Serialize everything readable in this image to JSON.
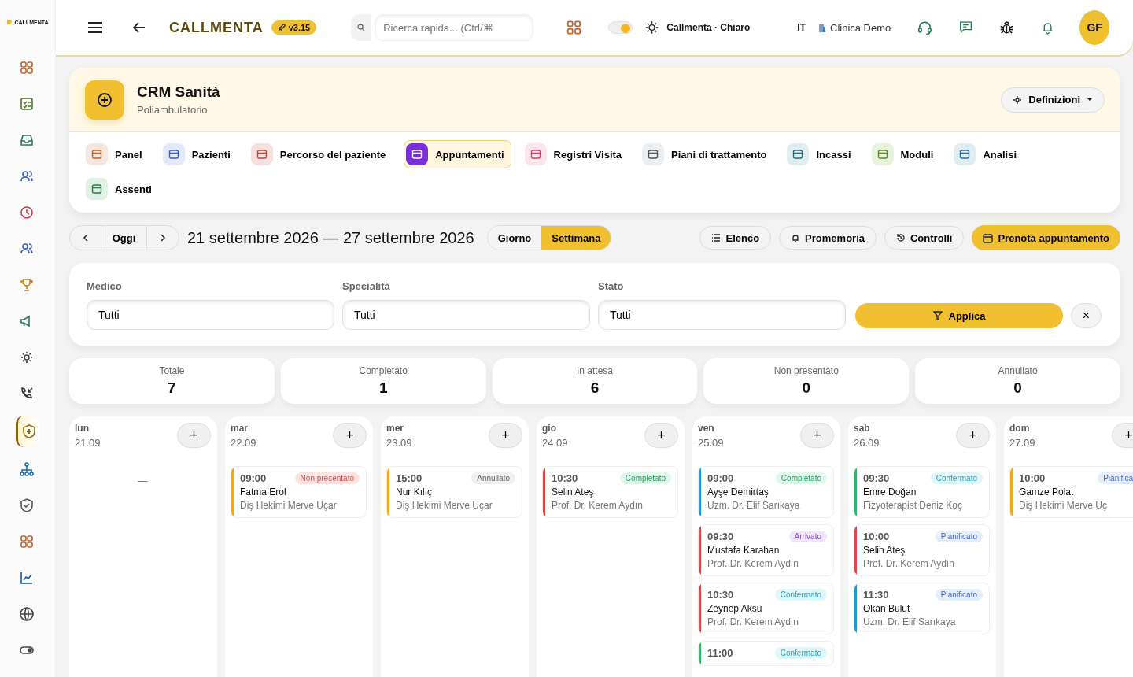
{
  "sidebar": {
    "logo": "CALLMENTA",
    "items": [
      {
        "selected": false
      },
      {
        "selected": false
      },
      {
        "selected": false
      },
      {
        "selected": false
      },
      {
        "selected": false
      },
      {
        "selected": false
      },
      {
        "selected": false
      },
      {
        "selected": false
      },
      {
        "selected": false
      },
      {
        "selected": false
      },
      {
        "selected": true
      },
      {
        "selected": false
      },
      {
        "selected": false
      },
      {
        "selected": false
      },
      {
        "selected": false
      },
      {
        "selected": false
      },
      {
        "selected": false
      }
    ]
  },
  "header": {
    "brand": "CALLMENTA",
    "version": "v3.15",
    "search": {
      "placeholder": "Ricerca rapida... (Ctrl/⌘"
    },
    "theme_toggle": {
      "on": true
    },
    "theme": "Callmenta · Chiaro",
    "language": "IT",
    "clinic": "Clinica Demo",
    "avatar": "GF"
  },
  "module": {
    "title": "CRM Sanità",
    "subtitle": "Poliambulatorio",
    "definitions": "Definizioni",
    "tabs": [
      {
        "label": "Panel",
        "selected": false
      },
      {
        "label": "Pazienti",
        "selected": false
      },
      {
        "label": "Percorso del paziente",
        "selected": false
      },
      {
        "label": "Appuntamenti",
        "selected": true
      },
      {
        "label": "Registri Visita",
        "selected": false
      },
      {
        "label": "Piani di trattamento",
        "selected": false
      },
      {
        "label": "Incassi",
        "selected": false
      },
      {
        "label": "Moduli",
        "selected": false
      },
      {
        "label": "Analisi",
        "selected": false
      },
      {
        "label": "Assenti",
        "selected": false
      }
    ]
  },
  "toolbar": {
    "today": "Oggi",
    "range": "21 settembre 2026 — 27 settembre 2026",
    "views": [
      {
        "label": "Giorno",
        "selected": false
      },
      {
        "label": "Settimana",
        "selected": true
      }
    ],
    "actions": [
      "Elenco",
      "Promemoria",
      "Controlli"
    ],
    "book": "Prenota appuntamento"
  },
  "filters": {
    "fields": [
      {
        "label": "Medico",
        "value": "Tutti"
      },
      {
        "label": "Specialità",
        "value": "Tutti"
      },
      {
        "label": "Stato",
        "value": "Tutti"
      }
    ],
    "apply": "Applica",
    "clear": "×"
  },
  "stats": [
    {
      "label": "Totale",
      "value": "7"
    },
    {
      "label": "Completato",
      "value": "1"
    },
    {
      "label": "In attesa",
      "value": "6"
    },
    {
      "label": "Non presentato",
      "value": "0"
    },
    {
      "label": "Annullato",
      "value": "0"
    }
  ],
  "days": [
    {
      "name": "lun",
      "date": "21.09",
      "add": "+",
      "empty": "—"
    },
    {
      "name": "mar",
      "date": "22.09",
      "add": "+",
      "appointments": [
        {
          "time": "09:00",
          "status": "Non presentato",
          "kind": "missed",
          "patient": "Fatma Erol",
          "doctor": "Diş Hekimi Merve Uçar",
          "color": "#f0a81c"
        }
      ]
    },
    {
      "name": "mer",
      "date": "23.09",
      "add": "+",
      "appointments": [
        {
          "time": "15:00",
          "status": "Annullato",
          "kind": "cancelled",
          "patient": "Nur Kılıç",
          "doctor": "Diş Hekimi Merve Uçar",
          "color": "#f0a81c"
        }
      ]
    },
    {
      "name": "gio",
      "date": "24.09",
      "add": "+",
      "appointments": [
        {
          "time": "10:30",
          "status": "Completato",
          "kind": "done",
          "patient": "Selin Ateş",
          "doctor": "Prof. Dr. Kerem Aydın",
          "color": "#e04848"
        }
      ]
    },
    {
      "name": "ven",
      "date": "25.09",
      "add": "+",
      "appointments": [
        {
          "time": "09:00",
          "status": "Completato",
          "kind": "done",
          "patient": "Ayşe Demirtaş",
          "doctor": "Uzm. Dr. Elif Sarıkaya",
          "color": "#1a9ad6"
        },
        {
          "time": "09:30",
          "status": "Arrivato",
          "kind": "arrived",
          "patient": "Mustafa Karahan",
          "doctor": "Prof. Dr. Kerem Aydın",
          "color": "#e04848"
        },
        {
          "time": "10:30",
          "status": "Confermato",
          "kind": "confirmed",
          "patient": "Zeynep Aksu",
          "doctor": "Prof. Dr. Kerem Aydın",
          "color": "#e04848"
        },
        {
          "time": "11:00",
          "status": "Confermato",
          "kind": "confirmed",
          "color": "#2fb86a"
        }
      ]
    },
    {
      "name": "sab",
      "date": "26.09",
      "add": "+",
      "appointments": [
        {
          "time": "09:30",
          "status": "Confermato",
          "kind": "confirmed",
          "patient": "Emre Doğan",
          "doctor": "Fizyoterapist Deniz Koç",
          "color": "#2fb86a"
        },
        {
          "time": "10:00",
          "status": "Pianificato",
          "kind": "planned",
          "patient": "Selin Ateş",
          "doctor": "Prof. Dr. Kerem Aydın",
          "color": "#e04848"
        },
        {
          "time": "11:30",
          "status": "Pianificato",
          "kind": "planned",
          "patient": "Okan Bulut",
          "doctor": "Uzm. Dr. Elif Sarıkaya",
          "color": "#1a9ad6"
        }
      ]
    },
    {
      "name": "dom",
      "date": "27.09",
      "add": "+",
      "appointments": [
        {
          "time": "10:00",
          "status": "Pianifica",
          "kind": "planned",
          "patient": "Gamze Polat",
          "doctor": "Diş Hekimi Merve Uç",
          "color": "#f0a81c"
        }
      ]
    }
  ]
}
